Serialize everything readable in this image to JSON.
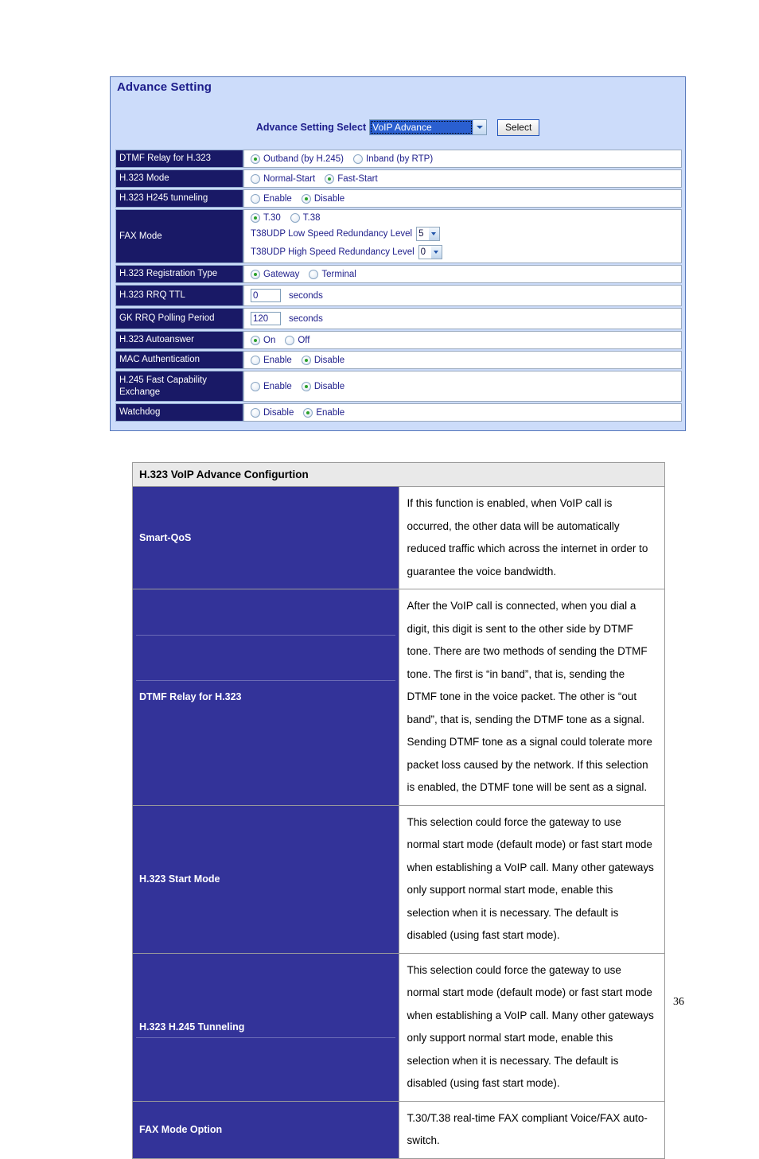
{
  "panel": {
    "title": "Advance Setting",
    "select_bar": {
      "label": "Advance Setting Select",
      "dropdown_value": "VoIP Advance",
      "button_label": "Select"
    },
    "rows": [
      {
        "label": "DTMF Relay for H.323",
        "options": [
          {
            "text": "Outband (by H.245)",
            "selected": true
          },
          {
            "text": "Inband (by RTP)",
            "selected": false
          }
        ]
      },
      {
        "label": "H.323 Mode",
        "options": [
          {
            "text": "Normal-Start",
            "selected": false
          },
          {
            "text": "Fast-Start",
            "selected": true
          }
        ]
      },
      {
        "label": "H.323 H245 tunneling",
        "options": [
          {
            "text": "Enable",
            "selected": false
          },
          {
            "text": "Disable",
            "selected": true
          }
        ]
      },
      {
        "label": "FAX Mode",
        "options": [
          {
            "text": "T.30",
            "selected": true
          },
          {
            "text": "T.38",
            "selected": false
          }
        ],
        "extra": [
          {
            "text": "T38UDP Low Speed Redundancy Level",
            "value": "5"
          },
          {
            "text": "T38UDP High Speed Redundancy Level",
            "value": "0"
          }
        ]
      },
      {
        "label": "H.323 Registration Type",
        "options": [
          {
            "text": "Gateway",
            "selected": true
          },
          {
            "text": "Terminal",
            "selected": false
          }
        ]
      },
      {
        "label": "H.323 RRQ TTL",
        "input_value": "0",
        "unit": "seconds"
      },
      {
        "label": "GK RRQ Polling Period",
        "input_value": "120",
        "unit": "seconds"
      },
      {
        "label": "H.323 Autoanswer",
        "options": [
          {
            "text": "On",
            "selected": true
          },
          {
            "text": "Off",
            "selected": false
          }
        ]
      },
      {
        "label": "MAC Authentication",
        "options": [
          {
            "text": "Enable",
            "selected": false
          },
          {
            "text": "Disable",
            "selected": true
          }
        ]
      },
      {
        "label": "H.245 Fast Capability Exchange",
        "options": [
          {
            "text": "Enable",
            "selected": false
          },
          {
            "text": "Disable",
            "selected": true
          }
        ]
      },
      {
        "label": "Watchdog",
        "options": [
          {
            "text": "Disable",
            "selected": false
          },
          {
            "text": "Enable",
            "selected": true
          }
        ]
      }
    ]
  },
  "doc_table": {
    "header": "H.323 VoIP Advance Configurtion",
    "rows": [
      {
        "key": "Smart-QoS",
        "value": "If this function is enabled, when VoIP call is occurred, the other data will be automatically reduced traffic which across the internet in order to guarantee the voice bandwidth."
      },
      {
        "key": "DTMF Relay for H.323",
        "value": "After the VoIP call is connected, when you dial a digit, this digit is sent to the other side by DTMF tone. There are two methods of sending the DTMF tone. The first is “in band”, that is, sending the DTMF tone in the voice packet. The other is “out band”, that is, sending the DTMF tone as a signal. Sending DTMF tone as a signal could tolerate more packet loss caused by the network. If this selection is enabled, the DTMF tone will be sent as a signal."
      },
      {
        "key": "H.323 Start Mode",
        "value": "This selection could force the gateway to use normal start mode (default mode) or fast start mode when establishing a VoIP call. Many other gateways only support normal start mode, enable this selection when it is necessary. The default is disabled (using fast start mode)."
      },
      {
        "key": "H.323 H.245 Tunneling",
        "value": "This selection could force the gateway to use normal start mode (default mode) or fast start mode when establishing a VoIP call. Many other gateways only support normal start mode, enable this selection when it is necessary. The default is disabled (using fast start mode)."
      },
      {
        "key": "FAX Mode Option",
        "value": "T.30/T.38 real-time FAX compliant Voice/FAX auto-switch."
      }
    ]
  },
  "page_number": "36"
}
